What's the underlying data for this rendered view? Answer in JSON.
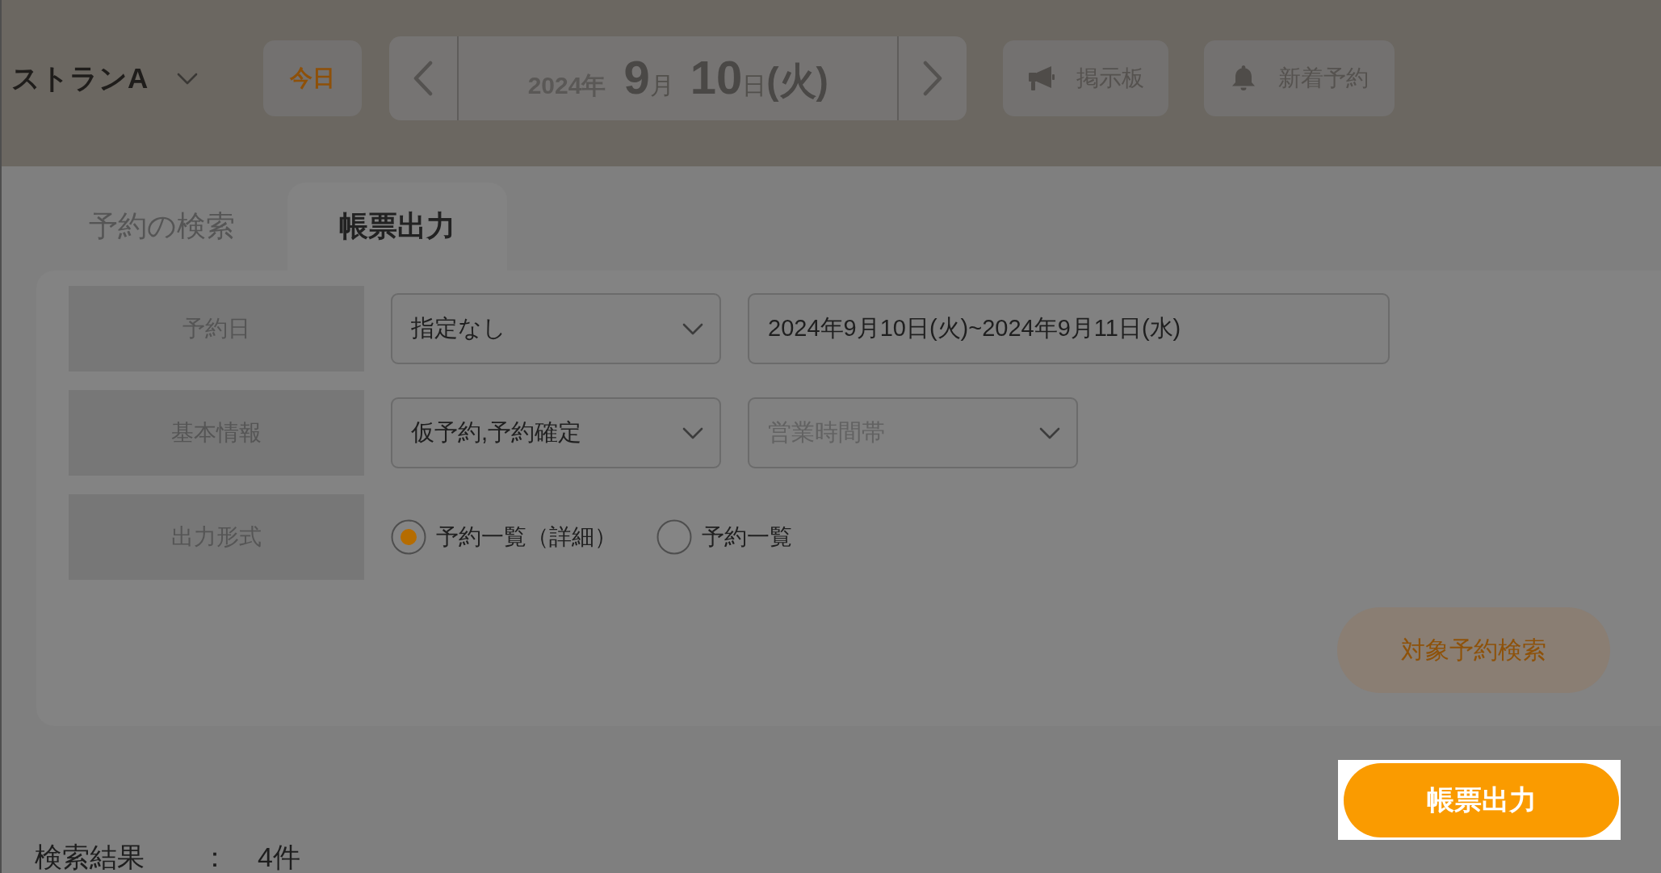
{
  "header": {
    "restaurant_selector": {
      "name": "ストランA"
    },
    "today_button": {
      "label": "今日"
    },
    "date": {
      "year": "2024年",
      "month": "9",
      "month_unit": "月",
      "day": "10",
      "day_unit": "日",
      "weekday": "(火)"
    },
    "buttons": [
      {
        "kind": "notice",
        "label": "掲示板"
      },
      {
        "kind": "alert",
        "label": "新着予約"
      }
    ]
  },
  "tabs": [
    {
      "label": "予約の検索",
      "selected": false
    },
    {
      "label": "帳票出力",
      "selected": true
    }
  ],
  "form": {
    "rows": [
      {
        "label": "予約日",
        "fields": [
          {
            "kind": "select",
            "value": "指定なし"
          },
          {
            "kind": "text",
            "value": "2024年9月10日(火)~2024年9月11日(水)"
          }
        ]
      },
      {
        "label": "基本情報",
        "fields": [
          {
            "kind": "select",
            "value": "仮予約,予約確定"
          },
          {
            "kind": "select",
            "placeholder": "営業時間帯"
          }
        ]
      },
      {
        "label": "出力形式",
        "fields": [
          {
            "kind": "radio",
            "label": "予約一覧（詳細）",
            "selected": true
          },
          {
            "kind": "radio",
            "label": "予約一覧",
            "selected": false
          }
        ]
      }
    ]
  },
  "search_button": {
    "label": "対象予約検索"
  },
  "output_button": {
    "label": "帳票出力",
    "highlighted": true
  },
  "results": {
    "label": "検索結果",
    "separator": "：",
    "count": "4件"
  }
}
